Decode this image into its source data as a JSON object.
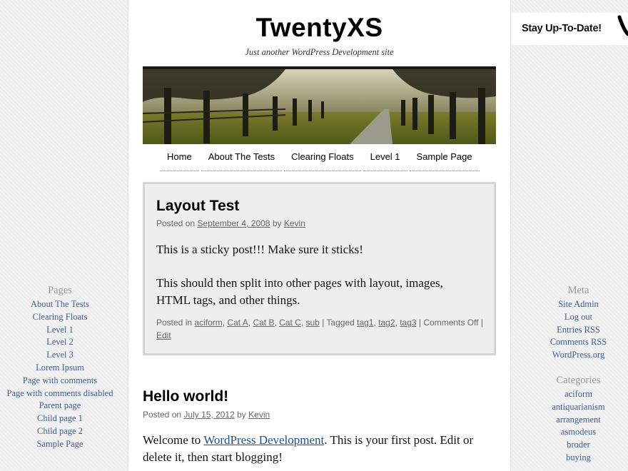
{
  "site": {
    "title": "TwentyXS",
    "tagline": "Just another WordPress Development site"
  },
  "nav": [
    "Home",
    "About The Tests",
    "Clearing Floats",
    "Level 1",
    "Sample Page"
  ],
  "stay_up_to_date": "Stay Up-To-Date!",
  "sticky_post": {
    "title": "Layout Test",
    "posted_on": "Posted on",
    "date": "September 4, 2008",
    "by": "by",
    "author": "Kevin",
    "para1": "This is a sticky post!!! Make sure it sticks!",
    "para2": "This should then split into other pages with layout, images, HTML tags, and other things.",
    "posted_in": "Posted in",
    "categories": [
      "aciform",
      "Cat A",
      "Cat B",
      "Cat C",
      "sub"
    ],
    "tagged": "| Tagged",
    "tags": [
      "tag1",
      "tag2",
      "tag3"
    ],
    "comments": "| Comments Off |",
    "edit": "Edit"
  },
  "post2": {
    "title": "Hello world!",
    "posted_on": "Posted on",
    "date": "July 15, 2012",
    "by": "by",
    "author": "Kevin",
    "text_before": "Welcome to",
    "link": "WordPress Development",
    "text_after": ". This is your first post. Edit or delete it, then start blogging!"
  },
  "left_sidebar": {
    "heading": "Pages",
    "items": [
      "About The Tests",
      "Clearing Floats",
      "Level 1",
      "Level 2",
      "Level 3",
      "Lorem Ipsum",
      "Page with comments",
      "Page with comments disabled",
      "Parent page",
      "Child page 1",
      "Child page 2",
      "Sample Page"
    ]
  },
  "right_sidebar": {
    "meta_heading": "Meta",
    "meta_items": [
      "Site Admin",
      "Log out",
      "Entries RSS",
      "Comments RSS",
      "WordPress.org"
    ],
    "cat_heading": "Categories",
    "cat_items": [
      "aciform",
      "antiquarianism",
      "arrangement",
      "asmodeus",
      "broder",
      "buying"
    ]
  },
  "colors": {
    "link_blue": "#3e5e98",
    "sticky_bg": "#eeeeee",
    "sticky_border": "#d4d4d4"
  }
}
